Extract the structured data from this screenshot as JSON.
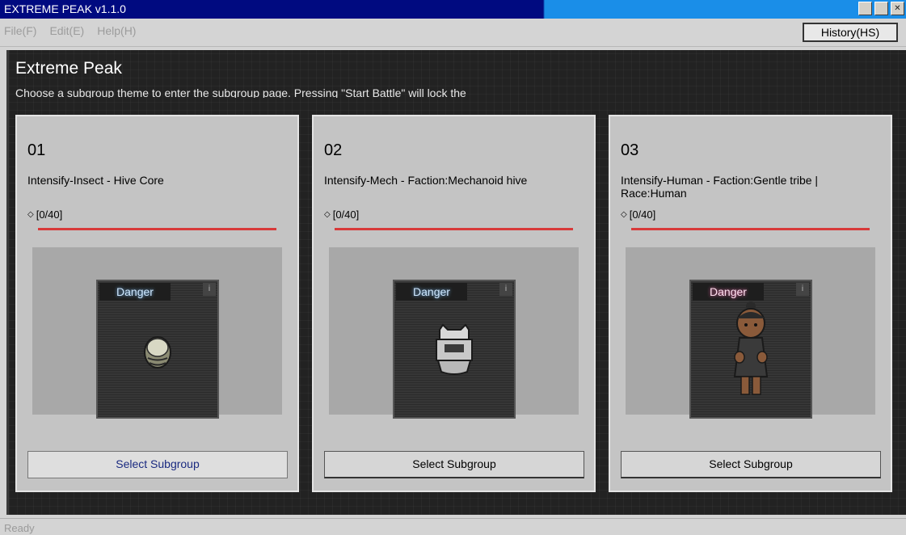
{
  "window": {
    "title": "EXTREME PEAK v1.1.0"
  },
  "menu": {
    "items": [
      "File(F)",
      "Edit(E)",
      "Help(H)"
    ],
    "history_label": "History(HS)"
  },
  "page": {
    "title": "Extreme Peak",
    "description": "Choose a subgroup theme to enter the subgroup page. Pressing \"Start Battle\" will lock the"
  },
  "cards": [
    {
      "number": "01",
      "title": "Intensify-Insect - Hive Core",
      "progress": "[0/40]",
      "tag": "Danger",
      "info": "i",
      "button": "Select Subgroup"
    },
    {
      "number": "02",
      "title": "Intensify-Mech - Faction:Mechanoid hive",
      "progress": "[0/40]",
      "tag": "Danger",
      "info": "i",
      "button": "Select Subgroup"
    },
    {
      "number": "03",
      "title": "Intensify-Human - Faction:Gentle tribe | Race:Human",
      "progress": "[0/40]",
      "tag": "Danger",
      "info": "i",
      "button": "Select Subgroup"
    }
  ],
  "status": {
    "text": "Ready"
  },
  "colors": {
    "title_bar": "#000a80",
    "title_bar_right": "#1a8ee8",
    "progress_line": "#d83a3a",
    "panel": "#2b2b2b"
  }
}
